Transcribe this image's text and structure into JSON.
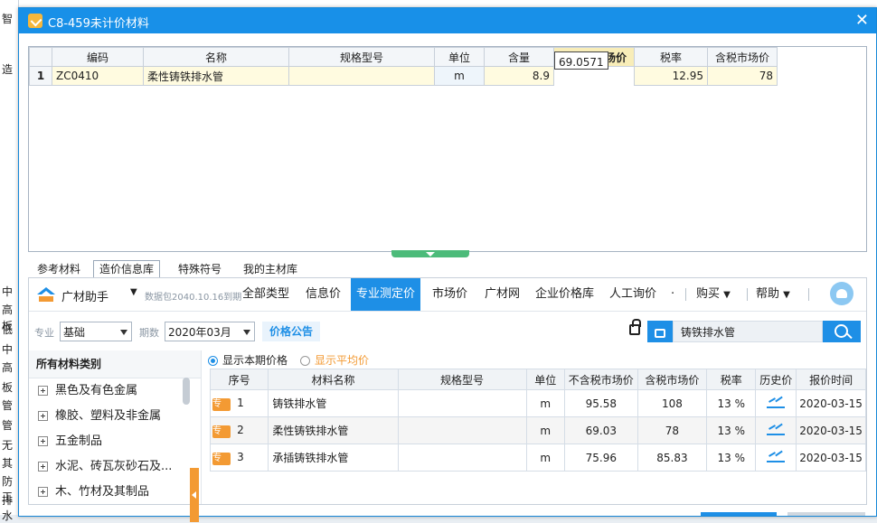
{
  "background": {
    "left_chars": [
      "智",
      "造",
      "高",
      "板",
      "中",
      "低",
      "中",
      "高",
      "板",
      "管",
      "管",
      "无",
      "其",
      "防工",
      "排水"
    ]
  },
  "dialog": {
    "title": "C8-459未计价材料",
    "close": "✕"
  },
  "top_grid": {
    "headers": [
      "编码",
      "名称",
      "规格型号",
      "单位",
      "含量",
      "不含税市场价",
      "税率",
      "含税市场价"
    ],
    "rows": [
      {
        "idx": "1",
        "code": "ZC0410",
        "name": "柔性铸铁排水管",
        "spec": "",
        "unit": "m",
        "qty": "8.9",
        "price_ex": "69.0571",
        "tax": "12.95",
        "price_in": "78"
      }
    ]
  },
  "tabs": [
    "参考材料",
    "造价信息库",
    "特殊符号",
    "我的主材库"
  ],
  "active_tab": "造价信息库",
  "nav": {
    "brand": "广材助手",
    "version": "数据包2040.10.16到期",
    "items": [
      "全部类型",
      "信息价",
      "专业测定价",
      "市场价",
      "广材网",
      "企业价格库",
      "人工询价",
      "·"
    ],
    "active": "专业测定价",
    "buy": "购买",
    "help": "帮助"
  },
  "filter": {
    "specialty_label": "专业",
    "specialty_value": "基础",
    "period_label": "期数",
    "period_value": "2020年03月",
    "notice": "价格公告",
    "search_value": "铸铁排水管"
  },
  "tree": {
    "header": "所有材料类别",
    "items": [
      "黑色及有色金属",
      "橡胶、塑料及非金属",
      "五金制品",
      "水泥、砖瓦灰砂石及...",
      "木、竹材及其制品"
    ]
  },
  "radios": {
    "current": "显示本期价格",
    "average": "显示平均价"
  },
  "result_grid": {
    "headers": [
      "序号",
      "材料名称",
      "规格型号",
      "单位",
      "不含税市场价",
      "含税市场价",
      "税率",
      "历史价",
      "报价时间"
    ],
    "tag": "专",
    "rows": [
      {
        "no": "1",
        "name": "铸铁排水管",
        "spec": "",
        "unit": "m",
        "price_ex": "95.58",
        "price_in": "108",
        "tax": "13 %",
        "date": "2020-03-15"
      },
      {
        "no": "2",
        "name": "柔性铸铁排水管",
        "spec": "",
        "unit": "m",
        "price_ex": "69.03",
        "price_in": "78",
        "tax": "13 %",
        "date": "2020-03-15"
      },
      {
        "no": "3",
        "name": "承插铸铁排水管",
        "spec": "",
        "unit": "m",
        "price_ex": "75.96",
        "price_in": "85.83",
        "tax": "13 %",
        "date": "2020-03-15"
      }
    ]
  },
  "colors": {
    "accent": "#1e8fe6",
    "orange": "#f39a33",
    "highlight_row": "#fffbe0"
  }
}
